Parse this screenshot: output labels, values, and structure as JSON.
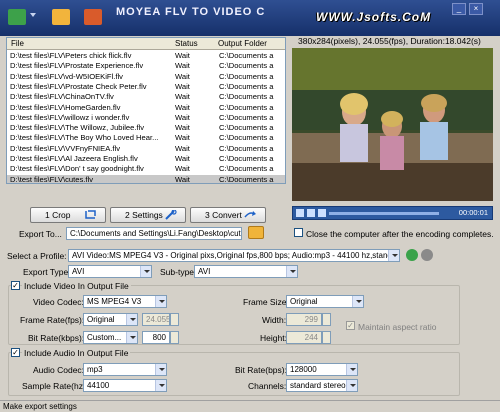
{
  "app": {
    "title": "MOYEA FLV TO VIDEO C",
    "watermark": "WWW.Jsofts.CoM"
  },
  "filelist": {
    "columns": [
      "File",
      "Status",
      "Output Folder"
    ],
    "rows": [
      {
        "file": "D:\\test files\\FLV\\Peters chick flick.flv",
        "status": "Wait",
        "folder": "C:\\Documents a"
      },
      {
        "file": "D:\\test files\\FLV\\Prostate Experience.flv",
        "status": "Wait",
        "folder": "C:\\Documents a"
      },
      {
        "file": "D:\\test files\\FLV\\vd-W5IOEKiFl.flv",
        "status": "Wait",
        "folder": "C:\\Documents a"
      },
      {
        "file": "D:\\test files\\FLV\\Prostate Check Peter.flv",
        "status": "Wait",
        "folder": "C:\\Documents a"
      },
      {
        "file": "D:\\test files\\FLV\\ChinaOnTV.flv",
        "status": "Wait",
        "folder": "C:\\Documents a"
      },
      {
        "file": "D:\\test files\\FLV\\HomeGarden.flv",
        "status": "Wait",
        "folder": "C:\\Documents a"
      },
      {
        "file": "D:\\test files\\FLV\\willowz i wonder.flv",
        "status": "Wait",
        "folder": "C:\\Documents a"
      },
      {
        "file": "D:\\test files\\FLV\\The Willowz, Jubilee.flv",
        "status": "Wait",
        "folder": "C:\\Documents a"
      },
      {
        "file": "D:\\test files\\FLV\\The Boy Who Loved Hear...",
        "status": "Wait",
        "folder": "C:\\Documents a"
      },
      {
        "file": "D:\\test files\\FLV\\VVFnyFNIEA.flv",
        "status": "Wait",
        "folder": "C:\\Documents a"
      },
      {
        "file": "D:\\test files\\FLV\\Al Jazeera English.flv",
        "status": "Wait",
        "folder": "C:\\Documents a"
      },
      {
        "file": "D:\\test files\\FLV\\Don' t say goodnight.flv",
        "status": "Wait",
        "folder": "C:\\Documents a"
      },
      {
        "file": "D:\\test files\\FLV\\cutes.flv",
        "status": "Wait",
        "folder": "C:\\Documents a"
      }
    ]
  },
  "preview": {
    "info": "380x284(pixels), 24.055(fps), Duration:18.042(s)",
    "time": "00:00:01"
  },
  "actions": {
    "crop": "1 Crop",
    "settings": "2 Settings",
    "convert": "3 Convert"
  },
  "export": {
    "label": "Export To...",
    "path": "C:\\Documents and Settings\\Li.Fang\\Desktop\\cute",
    "shutdown_label": "Close the computer after the encoding completes."
  },
  "profile": {
    "label": "Select a Profile:",
    "value": "AVI Video:MS MPEG4 V3 - Original pixs,Original fps,800 bps; Audio:mp3 - 44100 hz,standard s"
  },
  "export_type": {
    "label": "Export Type:",
    "value": "AVI",
    "subtype_label": "Sub-type:",
    "subtype_value": "AVI"
  },
  "video": {
    "include_label": "Include Video In Output File",
    "codec_label": "Video Codec:",
    "codec_value": "MS MPEG4 V3",
    "frame_size_label": "Frame Size:",
    "frame_size_value": "Original",
    "frame_rate_label": "Frame Rate(fps):",
    "frame_rate_value": "Original",
    "frame_rate_num": "24.055",
    "width_label": "Width:",
    "width_value": "299",
    "bitrate_label": "Bit Rate(kbps):",
    "bitrate_value": "Custom...",
    "bitrate_num": "800",
    "height_label": "Height:",
    "height_value": "244",
    "aspect_label": "Maintain aspect ratio"
  },
  "audio": {
    "include_label": "Include Audio In Output File",
    "codec_label": "Audio Codec:",
    "codec_value": "mp3",
    "bitrate_label": "Bit Rate(bps):",
    "bitrate_value": "128000",
    "sample_label": "Sample Rate(hz):",
    "sample_value": "44100",
    "channels_label": "Channels:",
    "channels_value": "standard stereo"
  },
  "status": {
    "text": "Make export settings"
  }
}
